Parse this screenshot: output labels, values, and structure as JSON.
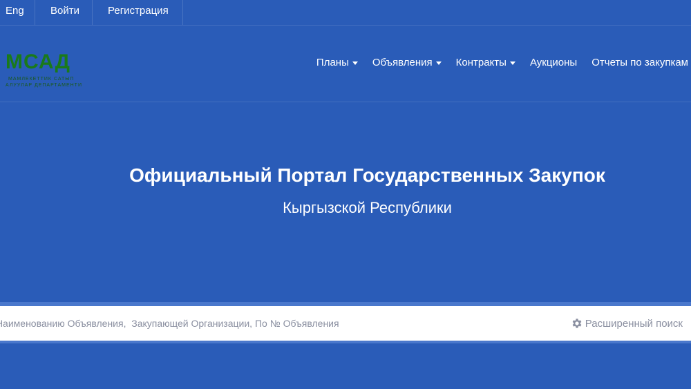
{
  "topbar": {
    "lang": "Eng",
    "login": "Войти",
    "register": "Регистрация"
  },
  "logo": {
    "main": "МСАД",
    "line1": "МАМЛЕКЕТТИК САТЫП",
    "line2": "АЛУУЛАР ДЕПАРТАМЕНТИ"
  },
  "nav": {
    "plans": "Планы",
    "announcements": "Объявления",
    "contracts": "Контракты",
    "auctions": "Аукционы",
    "reports": "Отчеты по закупкам"
  },
  "hero": {
    "title": "Официальный Портал Государственных Закупок",
    "subtitle": "Кыргызской Республики"
  },
  "search": {
    "placeholder": "Поиск по Наименованию Объявления,  Закупающей Организации, По № Объявления",
    "advanced": "Расширенный поиск"
  },
  "colors": {
    "background": "#2a5cb8",
    "logo_green": "#1a7a1a",
    "search_text": "#8a8fa0"
  }
}
